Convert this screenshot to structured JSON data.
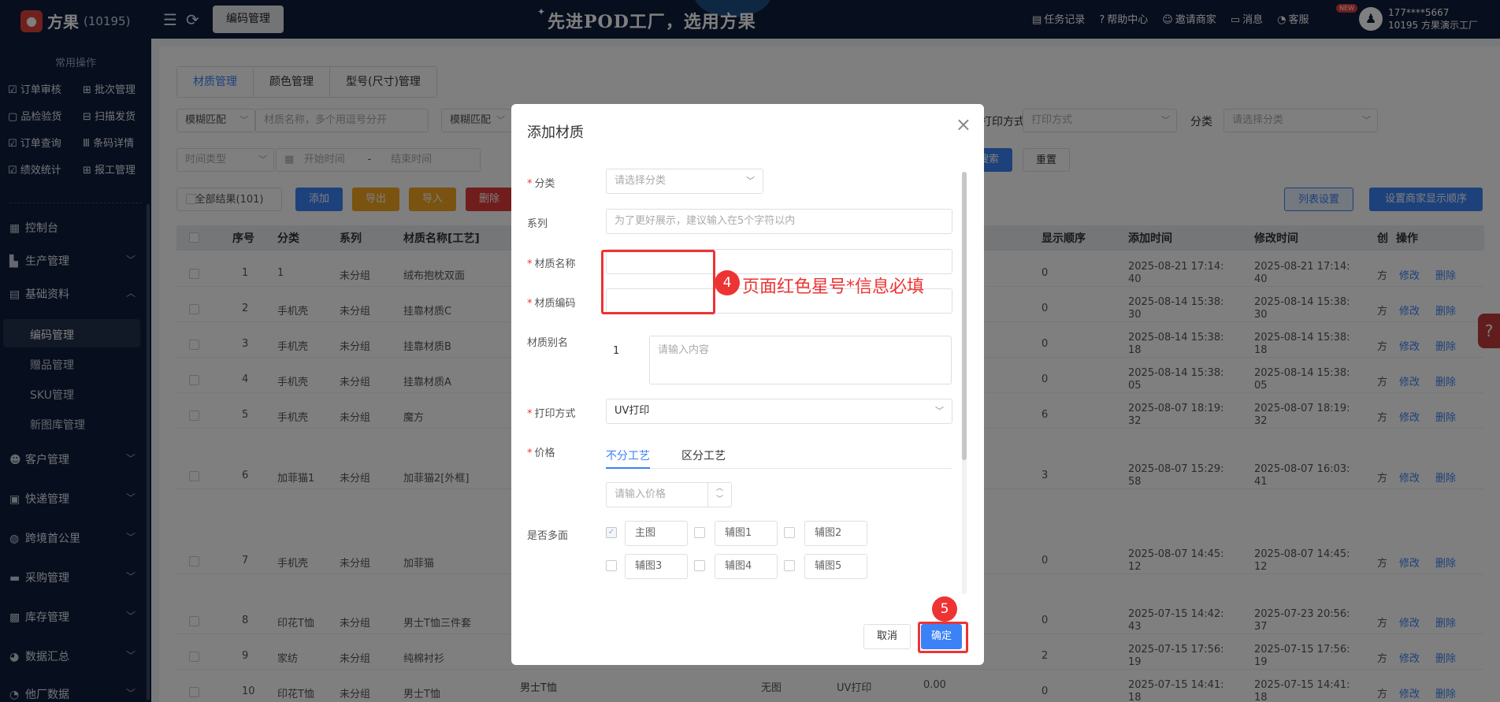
{
  "topbar": {
    "logo_text": "方果",
    "logo_id": "(10195)",
    "active_tab": "编码管理",
    "slogan": "先进POD工厂，选用方果",
    "links": [
      "任务记录",
      "帮助中心",
      "邀请商家",
      "消息",
      "客服"
    ],
    "new_badge": "NEW",
    "user_phone": "177****5667",
    "user_org": "10195 方果演示工厂"
  },
  "sidebar": {
    "quick_title": "常用操作",
    "quick_ops": [
      "订单审核",
      "批次管理",
      "品检验货",
      "扫描发货",
      "订单查询",
      "条码详情",
      "绩效统计",
      "报工管理"
    ],
    "menu": {
      "console": "控制台",
      "production": "生产管理",
      "basic": "基础资料",
      "code_mgmt": "编码管理",
      "gift_mgmt": "赠品管理",
      "sku_mgmt": "SKU管理",
      "newlib_mgmt": "新图库管理",
      "customer": "客户管理",
      "express": "快递管理",
      "cross": "跨境首公里",
      "purchase": "采购管理",
      "stock": "库存管理",
      "data": "数据汇总",
      "other": "他厂数据"
    }
  },
  "main": {
    "tabs": [
      "材质管理",
      "颜色管理",
      "型号(尺寸)管理"
    ],
    "filter": {
      "match1": "模糊匹配",
      "material_placeholder": "材质名称，多个用逗号分开",
      "match2": "模糊匹配",
      "print_label": "打印方式",
      "print_placeholder": "打印方式",
      "cat_label": "分类",
      "cat_placeholder": "请选择分类",
      "time_type": "时间类型",
      "start": "开始时间",
      "dash": "-",
      "end": "结束时间",
      "search": "搜索",
      "reset": "重置"
    },
    "toolbar": {
      "all": "全部结果(101)",
      "add": "添加",
      "export": "导出",
      "import": "导入",
      "delete": "删除",
      "list_settings": "列表设置",
      "merchant_order": "设置商家显示顺序"
    },
    "table": {
      "headers": [
        "序号",
        "分类",
        "系列",
        "材质名称[工艺]",
        "显示顺序",
        "添加时间",
        "修改时间",
        "创",
        "操作"
      ],
      "rows": [
        {
          "no": "1",
          "cat": "1",
          "series": "未分组",
          "name": "绒布抱枕双面",
          "order": "0",
          "added": "2025-08-21 17:14:40",
          "modified": "2025-08-21 17:14:40",
          "c": "方"
        },
        {
          "no": "2",
          "cat": "手机壳",
          "series": "未分组",
          "name": "挂靠材质C",
          "order": "0",
          "added": "2025-08-14 15:38:30",
          "modified": "2025-08-14 15:38:30",
          "c": "方"
        },
        {
          "no": "3",
          "cat": "手机壳",
          "series": "未分组",
          "name": "挂靠材质B",
          "order": "0",
          "added": "2025-08-14 15:38:18",
          "modified": "2025-08-14 15:38:18",
          "c": "方"
        },
        {
          "no": "4",
          "cat": "手机壳",
          "series": "未分组",
          "name": "挂靠材质A",
          "order": "0",
          "added": "2025-08-14 15:38:05",
          "modified": "2025-08-14 15:38:05",
          "c": "方"
        },
        {
          "no": "5",
          "cat": "手机壳",
          "series": "未分组",
          "name": "魔方",
          "order": "6",
          "added": "2025-08-07 18:19:32",
          "modified": "2025-08-07 18:19:32",
          "c": "方"
        },
        {
          "no": "6",
          "cat": "加菲猫1",
          "series": "未分组",
          "name": "加菲猫2[外框]",
          "order": "3",
          "added": "2025-08-07 15:29:58",
          "modified": "2025-08-07 16:03:41",
          "c": "方"
        },
        {
          "no": "7",
          "cat": "手机壳",
          "series": "未分组",
          "name": "加菲猫",
          "order": "0",
          "added": "2025-08-07 14:45:12",
          "modified": "2025-08-07 14:45:12",
          "c": "方"
        },
        {
          "no": "8",
          "cat": "印花T恤",
          "series": "未分组",
          "name": "男士T恤三件套",
          "order": "0",
          "added": "2025-07-15 14:42:43",
          "modified": "2025-07-23 20:56:37",
          "c": "方"
        },
        {
          "no": "9",
          "cat": "家纺",
          "series": "未分组",
          "name": "纯棉衬衫",
          "order": "2",
          "added": "2025-07-15 17:56:19",
          "modified": "2025-07-15 17:56:19",
          "c": "方"
        },
        {
          "no": "10",
          "cat": "印花T恤",
          "series": "未分组",
          "name": "男士T恤",
          "order": "0",
          "added": "2025-07-15 14:41:18",
          "modified": "2025-07-15 14:41:18",
          "c": "方"
        }
      ],
      "row10_extra": {
        "alias": "男士T恤",
        "img": "无图",
        "print": "UV打印",
        "price": "0.00"
      },
      "edit": "修改",
      "del": "删除",
      "page_hint": "页"
    }
  },
  "modal": {
    "title": "添加材质",
    "close": "×",
    "fields": {
      "category_label": "分类",
      "category_placeholder": "请选择分类",
      "series_label": "系列",
      "series_placeholder": "为了更好展示，建议输入在5个字符以内",
      "name_label": "材质名称",
      "code_label": "材质编码",
      "alias_label": "材质别名",
      "alias_index": "1",
      "alias_placeholder": "请输入内容",
      "print_label": "打印方式",
      "print_value": "UV打印",
      "price_label": "价格",
      "price_tab1": "不分工艺",
      "price_tab2": "区分工艺",
      "price_placeholder": "请输入价格",
      "multi_label": "是否多面",
      "multi_options": [
        "主图",
        "辅图1",
        "辅图2",
        "辅图3",
        "辅图4",
        "辅图5"
      ]
    },
    "cancel": "取消",
    "confirm": "确定"
  },
  "annotations": {
    "step4": "4",
    "step4_text": "页面红色星号*信息必填",
    "step5": "5"
  },
  "colors": {
    "primary": "#3b82f6",
    "annotation": "#e33333",
    "sidebar": "#0f1d3a"
  }
}
